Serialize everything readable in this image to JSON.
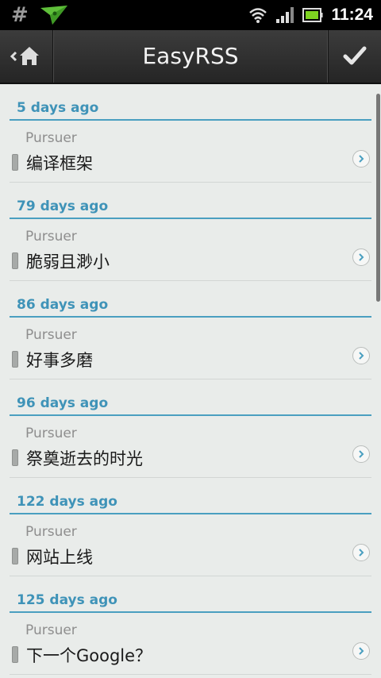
{
  "status_bar": {
    "time": "11:24"
  },
  "action_bar": {
    "title": "EasyRSS"
  },
  "sections": [
    {
      "header": "5 days ago",
      "items": [
        {
          "source": "Pursuer",
          "title": "编译框架"
        }
      ]
    },
    {
      "header": "79 days ago",
      "items": [
        {
          "source": "Pursuer",
          "title": "脆弱且渺小"
        }
      ]
    },
    {
      "header": "86 days ago",
      "items": [
        {
          "source": "Pursuer",
          "title": "好事多磨"
        }
      ]
    },
    {
      "header": "96 days ago",
      "items": [
        {
          "source": "Pursuer",
          "title": "祭奠逝去的时光"
        }
      ]
    },
    {
      "header": "122 days ago",
      "items": [
        {
          "source": "Pursuer",
          "title": "网站上线"
        }
      ]
    },
    {
      "header": "125 days ago",
      "items": [
        {
          "source": "Pursuer",
          "title": "下一个Google？"
        }
      ]
    }
  ],
  "colors": {
    "accent": "#3f93b8",
    "divider": "#4a9fc0",
    "background": "#e9ecea"
  }
}
